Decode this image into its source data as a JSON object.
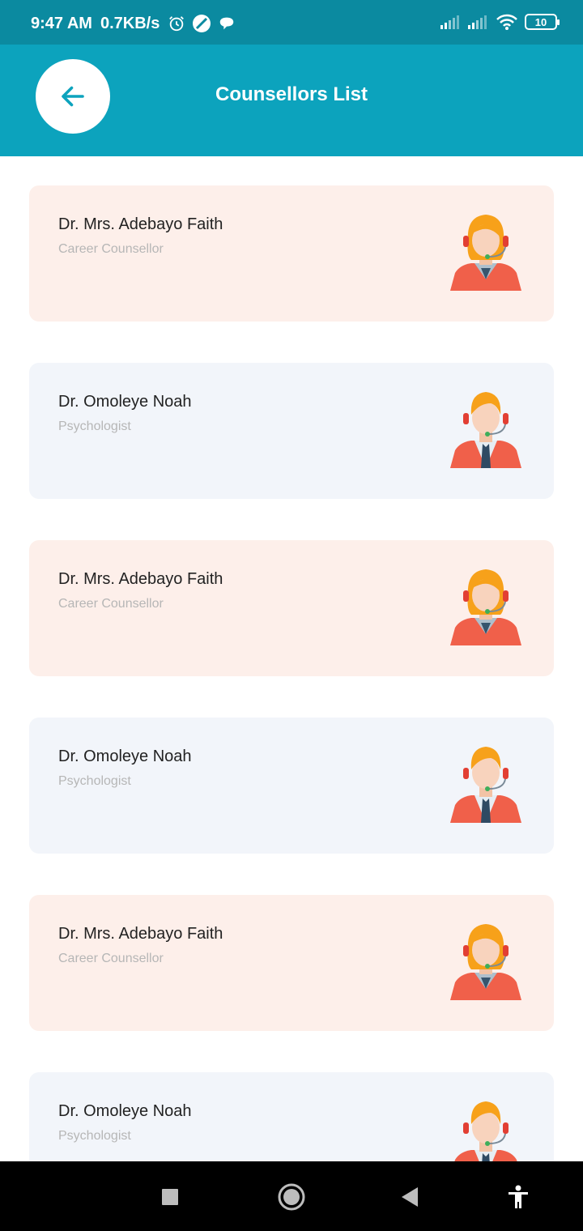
{
  "status_bar": {
    "time": "9:47 AM",
    "speed": "0.7KB/s",
    "battery": "10",
    "icons": [
      "alarm-icon",
      "compass-icon",
      "chat-bubble-icon",
      "signal-icon",
      "signal-icon",
      "wifi-icon",
      "battery-icon"
    ]
  },
  "app_bar": {
    "title": "Counsellors List",
    "back_icon": "arrow-left-icon"
  },
  "colors": {
    "status_bar": "#0b8aa0",
    "app_bar": "#0ca3bd",
    "card_pink": "#fdefea",
    "card_blue": "#f2f5fa",
    "name_text": "#222222",
    "role_text": "#b6b6b6"
  },
  "counsellors": [
    {
      "name": "Dr. Mrs. Adebayo Faith",
      "role": "Career Counsellor",
      "avatar": "female-support-agent-icon"
    },
    {
      "name": "Dr. Omoleye Noah",
      "role": "Psychologist",
      "avatar": "male-support-agent-icon"
    },
    {
      "name": "Dr. Mrs. Adebayo Faith",
      "role": "Career Counsellor",
      "avatar": "female-support-agent-icon"
    },
    {
      "name": "Dr. Omoleye Noah",
      "role": "Psychologist",
      "avatar": "male-support-agent-icon"
    },
    {
      "name": "Dr. Mrs. Adebayo Faith",
      "role": "Career Counsellor",
      "avatar": "female-support-agent-icon"
    },
    {
      "name": "Dr. Omoleye Noah",
      "role": "Psychologist",
      "avatar": "male-support-agent-icon"
    }
  ],
  "nav_bar": {
    "buttons": [
      "recents-square-icon",
      "home-circle-icon",
      "back-triangle-icon",
      "accessibility-icon"
    ]
  }
}
